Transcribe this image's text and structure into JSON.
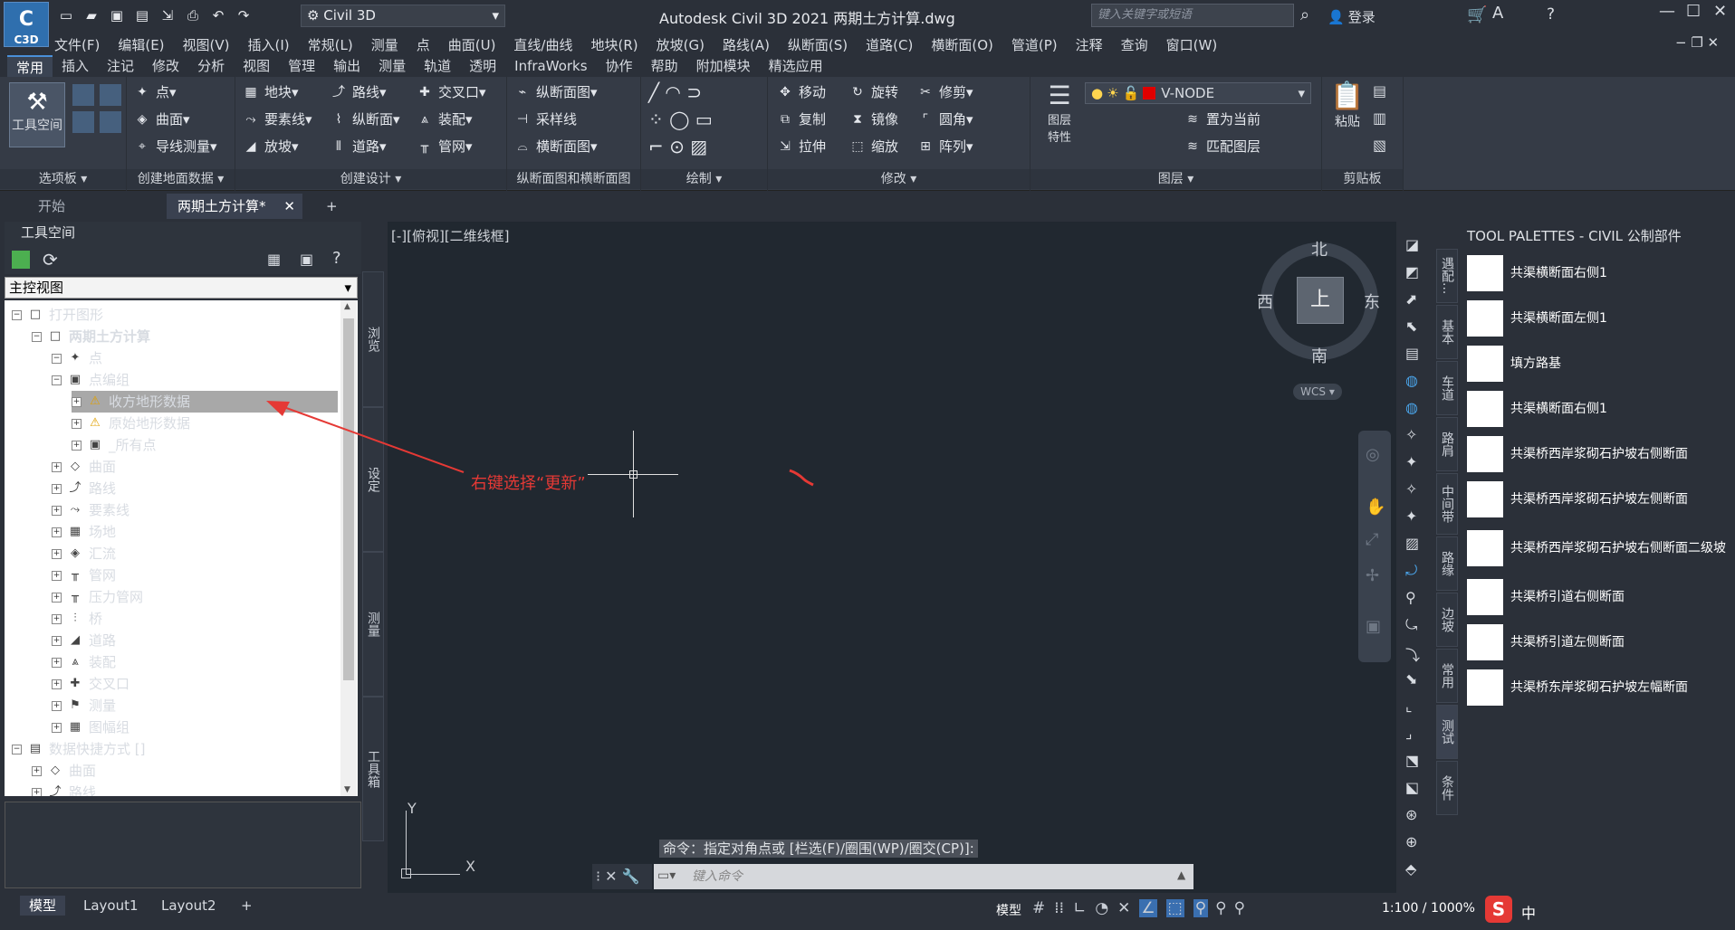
{
  "app": {
    "badge": "C3D",
    "workspace": "Civil 3D",
    "title": "Autodesk Civil 3D 2021    两期土方计算.dwg",
    "search_placeholder": "键入关键字或短语",
    "login": "登录"
  },
  "menubar": [
    "文件(F)",
    "编辑(E)",
    "视图(V)",
    "插入(I)",
    "常规(L)",
    "测量",
    "点",
    "曲面(U)",
    "直线/曲线",
    "地块(R)",
    "放坡(G)",
    "路线(A)",
    "纵断面(S)",
    "道路(C)",
    "横断面(O)",
    "管道(P)",
    "注释",
    "查询",
    "窗口(W)"
  ],
  "ribbon_tabs": [
    "常用",
    "插入",
    "注记",
    "修改",
    "分析",
    "视图",
    "管理",
    "输出",
    "测量",
    "轨道",
    "透明",
    "InfraWorks",
    "协作",
    "帮助",
    "附加模块",
    "精选应用"
  ],
  "ribbon": {
    "p1": {
      "title": "选项板",
      "big": "工具空间"
    },
    "p2": {
      "title": "创建地面数据",
      "a": "点",
      "b": "曲面",
      "c": "导线测量"
    },
    "p3": {
      "title": "创建设计",
      "a": "地块",
      "b": "要素线",
      "c": "放坡",
      "d": "路线",
      "e": "纵断面",
      "f": "道路",
      "g": "交叉口",
      "h": "装配",
      "i": "管网"
    },
    "p4": {
      "title": "纵断面图和横断面图",
      "a": "纵断面图",
      "b": "采样线",
      "c": "横断面图"
    },
    "p5": {
      "title": "绘制"
    },
    "p6": {
      "title": "修改",
      "a": "移动",
      "b": "旋转",
      "c": "修剪",
      "d": "复制",
      "e": "镜像",
      "f": "圆角",
      "g": "拉伸",
      "h": "缩放",
      "i": "阵列"
    },
    "p7": {
      "title": "图层",
      "layer": "V-NODE",
      "a": "图层",
      "b": "特性",
      "c": "置为当前",
      "d": "匹配图层"
    },
    "p8": {
      "title": "剪贴板",
      "a": "粘贴"
    }
  },
  "doctabs": {
    "start": "开始",
    "current": "两期土方计算*"
  },
  "toolspace": {
    "header": "工具空间",
    "view": "主控视图",
    "side_tabs": [
      "浏览",
      "设定",
      "测量",
      "工具箱"
    ],
    "tree": [
      {
        "label": "打开图形",
        "level": 0
      },
      {
        "label": "两期土方计算",
        "level": 1,
        "bold": true
      },
      {
        "label": "点",
        "level": 2
      },
      {
        "label": "点编组",
        "level": 2
      },
      {
        "label": "收方地形数据",
        "level": 3,
        "selected": true
      },
      {
        "label": "原始地形数据",
        "level": 3
      },
      {
        "label": "_所有点",
        "level": 3
      },
      {
        "label": "曲面",
        "level": 2
      },
      {
        "label": "路线",
        "level": 2
      },
      {
        "label": "要素线",
        "level": 2
      },
      {
        "label": "场地",
        "level": 2
      },
      {
        "label": "汇流",
        "level": 2
      },
      {
        "label": "管网",
        "level": 2
      },
      {
        "label": "压力管网",
        "level": 2
      },
      {
        "label": "桥",
        "level": 2
      },
      {
        "label": "道路",
        "level": 2
      },
      {
        "label": "装配",
        "level": 2
      },
      {
        "label": "交叉口",
        "level": 2
      },
      {
        "label": "测量",
        "level": 2
      },
      {
        "label": "图幅组",
        "level": 2
      },
      {
        "label": "数据快捷方式 []",
        "level": 0
      },
      {
        "label": "曲面",
        "level": 1
      },
      {
        "label": "路线",
        "level": 1
      }
    ]
  },
  "canvas": {
    "view_label": "[-][俯视][二维线框]",
    "compass": {
      "n": "北",
      "s": "南",
      "e": "东",
      "w": "西",
      "top": "上",
      "wcs": "WCS"
    },
    "annotation": "右键选择“更新”",
    "axis_x": "X",
    "axis_y": "Y",
    "command_history": "命令：指定对角点或 [栏选(F)/圈围(WP)/圈交(CP)]:",
    "command_placeholder": "键入命令"
  },
  "tool_palettes": {
    "title": "TOOL PALETTES - CIVIL 公制部件",
    "tabs": [
      "遇配...",
      "基本",
      "车道",
      "路肩",
      "中间带",
      "路缘",
      "边坡",
      "常用",
      "测试",
      "条件"
    ],
    "items": [
      "共渠横断面右侧1",
      "共渠横断面左侧1",
      "填方路基",
      "共渠横断面右侧1",
      "共渠桥西岸浆砌石护坡右侧断面",
      "共渠桥西岸浆砌石护坡左侧断面",
      "共渠桥西岸浆砌石护坡右侧断面二级坡",
      "共渠桥引道右侧断面",
      "共渠桥引道左侧断面",
      "共渠桥东岸浆砌石护坡左幅断面"
    ]
  },
  "status": {
    "tabs": [
      "模型",
      "Layout1",
      "Layout2"
    ],
    "model": "模型",
    "scale": "1:100 / 1000%",
    "ime": "中"
  },
  "colors": {
    "accent": "#4a90d9",
    "annotation": "#e53935",
    "layer": "#e00000"
  }
}
